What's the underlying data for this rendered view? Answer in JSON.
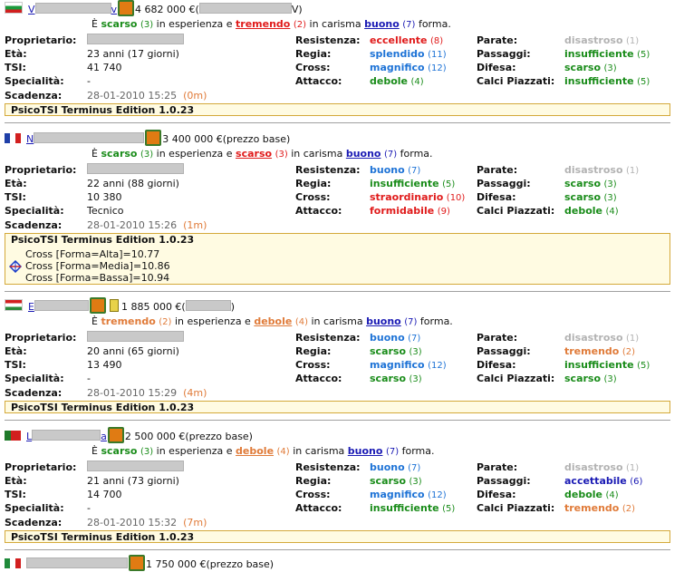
{
  "labels": {
    "owner": "Proprietario:",
    "age": "Età:",
    "tsi": "TSI:",
    "spec": "Specialità:",
    "deadline": "Scadenza:",
    "stamina": "Resistenza:",
    "playmaking": "Regia:",
    "winger": "Cross:",
    "scoring": "Attacco:",
    "keeper": "Parate:",
    "passing": "Passaggi:",
    "defending": "Difesa:",
    "setpieces": "Calci Piazzati:",
    "sent_prefix": "È",
    "sent_exp": "in esperienza e",
    "sent_lead": "in carisma",
    "sent_form": "forma."
  },
  "colors": {
    "green": "#1a8c1a",
    "blue": "#1e73d6",
    "red": "#e01b1b",
    "orange": "#e07b39",
    "darkblue": "#1a1ab4",
    "gray": "#b3b3b3"
  },
  "players": [
    {
      "flag": "bulgaria",
      "header": {
        "pre": "V",
        "mid": "v",
        "price": "4 682 000 €(",
        "post": "V)"
      },
      "exp": {
        "w": "scarso",
        "l": "(3)",
        "c": "green",
        "u": false
      },
      "lead": {
        "w": "tremendo",
        "l": "(2)",
        "c": "red",
        "u": true
      },
      "form": {
        "w": "buono",
        "l": "(7)",
        "c": "darkblue",
        "u": true
      },
      "owner": "",
      "age": "23 anni (17 giorni)",
      "tsi": "41 740",
      "spec": "-",
      "deadline": "28-01-2010 15:25",
      "deadline_rel": "(0m)",
      "skills": {
        "stamina": {
          "w": "eccellente",
          "l": "(8)",
          "c": "red"
        },
        "playmaking": {
          "w": "splendido",
          "l": "(11)",
          "c": "blue"
        },
        "winger": {
          "w": "magnifico",
          "l": "(12)",
          "c": "blue"
        },
        "scoring": {
          "w": "debole",
          "l": "(4)",
          "c": "green"
        },
        "keeper": {
          "w": "disastroso",
          "l": "(1)",
          "c": "gray"
        },
        "passing": {
          "w": "insufficiente",
          "l": "(5)",
          "c": "green"
        },
        "defending": {
          "w": "scarso",
          "l": "(3)",
          "c": "green"
        },
        "setpieces": {
          "w": "insufficiente",
          "l": "(5)",
          "c": "green"
        }
      },
      "ped_title": "PsicoTSI Terminus Edition 1.0.23",
      "cross": []
    },
    {
      "flag": "france",
      "header": {
        "pre": "N",
        "mid": "",
        "price": "3 400 000 €(prezzo base)",
        "post": ""
      },
      "exp": {
        "w": "scarso",
        "l": "(3)",
        "c": "green",
        "u": false
      },
      "lead": {
        "w": "scarso",
        "l": "(3)",
        "c": "red",
        "u": true
      },
      "form": {
        "w": "buono",
        "l": "(7)",
        "c": "darkblue",
        "u": true
      },
      "owner": "",
      "age": "22 anni (88 giorni)",
      "tsi": "10 380",
      "spec": "Tecnico",
      "deadline": "28-01-2010 15:26",
      "deadline_rel": "(1m)",
      "skills": {
        "stamina": {
          "w": "buono",
          "l": "(7)",
          "c": "blue"
        },
        "playmaking": {
          "w": "insufficiente",
          "l": "(5)",
          "c": "green"
        },
        "winger": {
          "w": "straordinario",
          "l": "(10)",
          "c": "red"
        },
        "scoring": {
          "w": "formidabile",
          "l": "(9)",
          "c": "red"
        },
        "keeper": {
          "w": "disastroso",
          "l": "(1)",
          "c": "gray"
        },
        "passing": {
          "w": "scarso",
          "l": "(3)",
          "c": "green"
        },
        "defending": {
          "w": "scarso",
          "l": "(3)",
          "c": "green"
        },
        "setpieces": {
          "w": "debole",
          "l": "(4)",
          "c": "green"
        }
      },
      "ped_title": "PsicoTSI Terminus Edition 1.0.23",
      "cross": [
        "Cross [Forma=Alta]=10.77",
        "Cross [Forma=Media]=10.86",
        "Cross [Forma=Bassa]=10.94"
      ]
    },
    {
      "flag": "hungary",
      "header": {
        "pre": "E",
        "mid": "",
        "price": "1 885 000 €(",
        "post": ")"
      },
      "exp": {
        "w": "tremendo",
        "l": "(2)",
        "c": "orange",
        "u": false
      },
      "lead": {
        "w": "debole",
        "l": "(4)",
        "c": "orange",
        "u": true
      },
      "form": {
        "w": "buono",
        "l": "(7)",
        "c": "darkblue",
        "u": true
      },
      "owner": "",
      "age": "20 anni (65 giorni)",
      "tsi": "13 490",
      "spec": "-",
      "deadline": "28-01-2010 15:29",
      "deadline_rel": "(4m)",
      "skills": {
        "stamina": {
          "w": "buono",
          "l": "(7)",
          "c": "blue"
        },
        "playmaking": {
          "w": "scarso",
          "l": "(3)",
          "c": "green"
        },
        "winger": {
          "w": "magnifico",
          "l": "(12)",
          "c": "blue"
        },
        "scoring": {
          "w": "scarso",
          "l": "(3)",
          "c": "green"
        },
        "keeper": {
          "w": "disastroso",
          "l": "(1)",
          "c": "gray"
        },
        "passing": {
          "w": "tremendo",
          "l": "(2)",
          "c": "orange"
        },
        "defending": {
          "w": "insufficiente",
          "l": "(5)",
          "c": "green"
        },
        "setpieces": {
          "w": "scarso",
          "l": "(3)",
          "c": "green"
        }
      },
      "ped_title": "PsicoTSI Terminus Edition 1.0.23",
      "cross": []
    },
    {
      "flag": "portugal",
      "header": {
        "pre": "L",
        "mid": "a",
        "price": "2 500 000 €(prezzo base)",
        "post": ""
      },
      "exp": {
        "w": "scarso",
        "l": "(3)",
        "c": "green",
        "u": false
      },
      "lead": {
        "w": "debole",
        "l": "(4)",
        "c": "orange",
        "u": true
      },
      "form": {
        "w": "buono",
        "l": "(7)",
        "c": "darkblue",
        "u": true
      },
      "owner": "",
      "age": "21 anni (73 giorni)",
      "tsi": "14 700",
      "spec": "-",
      "deadline": "28-01-2010 15:32",
      "deadline_rel": "(7m)",
      "skills": {
        "stamina": {
          "w": "buono",
          "l": "(7)",
          "c": "blue"
        },
        "playmaking": {
          "w": "scarso",
          "l": "(3)",
          "c": "green"
        },
        "winger": {
          "w": "magnifico",
          "l": "(12)",
          "c": "blue"
        },
        "scoring": {
          "w": "insufficiente",
          "l": "(5)",
          "c": "green"
        },
        "keeper": {
          "w": "disastroso",
          "l": "(1)",
          "c": "gray"
        },
        "passing": {
          "w": "accettabile",
          "l": "(6)",
          "c": "darkblue"
        },
        "defending": {
          "w": "debole",
          "l": "(4)",
          "c": "green"
        },
        "setpieces": {
          "w": "tremendo",
          "l": "(2)",
          "c": "orange"
        }
      },
      "ped_title": "PsicoTSI Terminus Edition 1.0.23",
      "cross": []
    },
    {
      "flag": "italy",
      "header": {
        "pre": "",
        "mid": "",
        "price": "1 750 000 €(prezzo base)",
        "post": ""
      },
      "partial": true
    }
  ]
}
